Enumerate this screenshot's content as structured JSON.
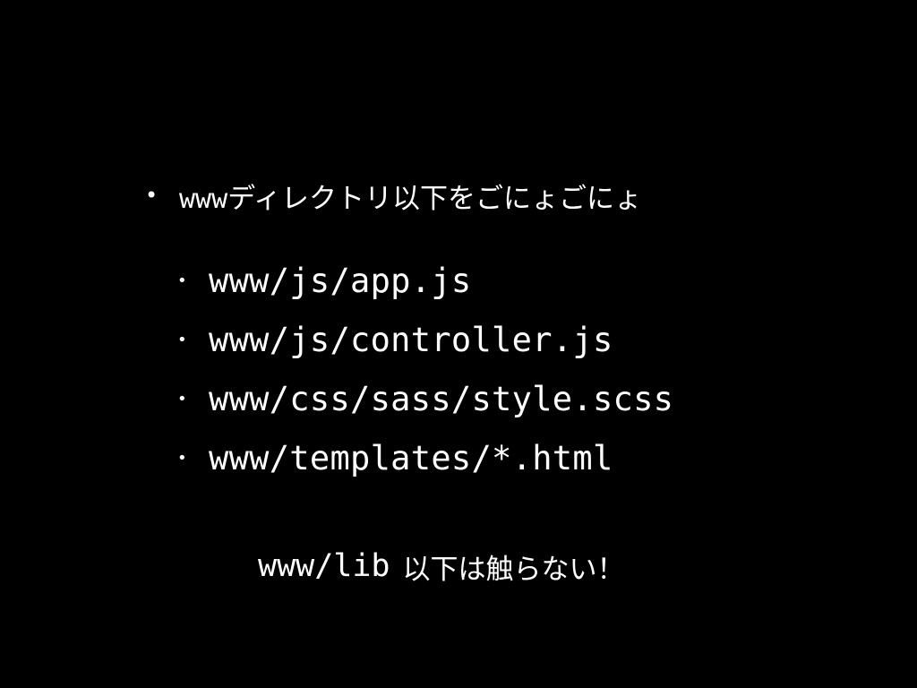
{
  "slide": {
    "main_bullet": {
      "prefix": "www",
      "text": "ディレクトリ以下をごにょごにょ"
    },
    "sub_bullets": [
      "www/js/app.js",
      "www/js/controller.js",
      "www/css/sass/style.scss",
      "www/templates/*.html"
    ],
    "note": {
      "path": "www/lib",
      "text": "以下は触らない！"
    },
    "bullet_glyph": "•",
    "colors": {
      "background": "#000000",
      "text": "#ffffff"
    }
  }
}
